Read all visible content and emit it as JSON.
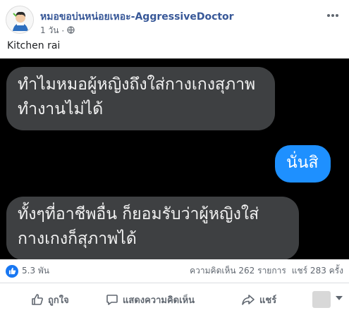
{
  "post": {
    "author": "หมอขอบ่นหน่อยเหอะ-AggressiveDoctor",
    "time": "1 วัน",
    "time_sep": "·",
    "caption": "Kitchen rai"
  },
  "chat": {
    "messages": [
      {
        "side": "in",
        "lines": [
          "ทำไมหมอผู้หญิงถึงใส่กางเกงสุภาพ",
          "ทำงานไม่ได้"
        ]
      },
      {
        "side": "out",
        "lines": [
          "นั่นสิ"
        ]
      },
      {
        "side": "in",
        "lines": [
          "ทั้งๆที่อาชีพอื่น ก็ยอมรับว่าผู้หญิงใส่",
          "กางเกงก็สุภาพได้"
        ]
      }
    ]
  },
  "stats": {
    "reactions_count": "5.3 พัน",
    "comments": "ความคิดเห็น 262 รายการ",
    "shares": "แชร์ 283 ครั้ง"
  },
  "actions": {
    "like": "ถูกใจ",
    "comment": "แสดงความคิดเห็น",
    "share": "แชร์"
  },
  "colors": {
    "author": "#385898",
    "chat_background": "#000000",
    "incoming_bubble": "#3e4042",
    "outgoing_bubble": "#1e90ff",
    "like_badge": "#1877f2"
  },
  "icons": {
    "globe": "globe-icon",
    "more": "more-dots-icon",
    "like_badge": "thumbs-up-icon",
    "like": "thumbs-up-outline-icon",
    "comment": "comment-bubble-icon",
    "share": "share-arrow-icon"
  }
}
